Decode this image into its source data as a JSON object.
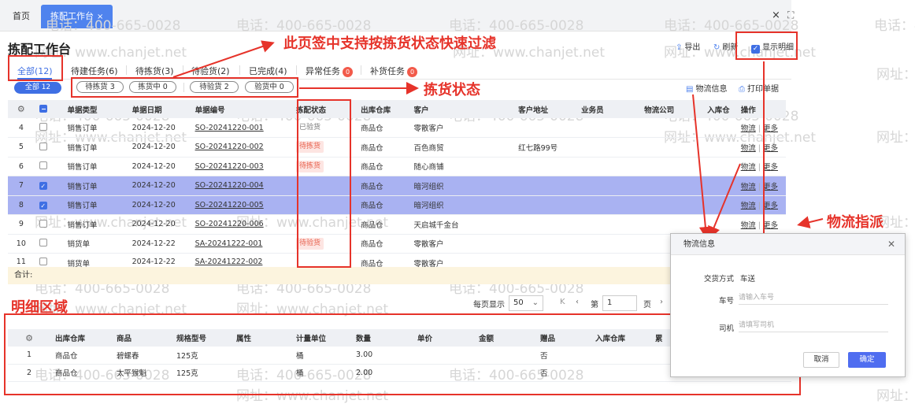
{
  "tabs": {
    "home": "首页",
    "active": "拣配工作台",
    "active_close": "×"
  },
  "window": {
    "close": "×",
    "max": "⛶"
  },
  "watermarks": {
    "phone": "电话：400-665-0028",
    "site": "网址：www.chanjet.net"
  },
  "header": {
    "title": "拣配工作台",
    "export": "导出",
    "refresh": "刷新",
    "show_detail": "显示明细"
  },
  "status_tabs": [
    {
      "label": "全部(12)"
    },
    {
      "label": "待建任务(6)"
    },
    {
      "label": "待拣货(3)"
    },
    {
      "label": "待验货(2)"
    },
    {
      "label": "已完成(4)"
    },
    {
      "label": "异常任务",
      "badge": "0"
    },
    {
      "label": "补货任务",
      "badge": "0"
    }
  ],
  "filters": {
    "all": "全部 12",
    "pills": [
      "待拣货 3",
      "拣货中 0",
      "待验货 2",
      "验货中 0"
    ]
  },
  "actions": {
    "logistics": "物流信息",
    "print": "打印单据"
  },
  "table": {
    "columns": [
      "单据类型",
      "单据日期",
      "单据编号",
      "拣配状态",
      "出库仓库",
      "客户",
      "客户地址",
      "业务员",
      "物流公司",
      "入库仓",
      "操作"
    ],
    "rows": [
      {
        "no": "4",
        "type": "销售订单",
        "date": "2024-12-20",
        "code": "SO-20241220-001",
        "status": "已验货",
        "warehouse": "商品仓",
        "customer": "零散客户",
        "address": "",
        "checked": false
      },
      {
        "no": "5",
        "type": "销售订单",
        "date": "2024-12-20",
        "code": "SO-20241220-002",
        "status": "待拣货",
        "warehouse": "商品仓",
        "customer": "百色商贸",
        "address": "红七路99号",
        "checked": false
      },
      {
        "no": "6",
        "type": "销售订单",
        "date": "2024-12-20",
        "code": "SO-20241220-003",
        "status": "待拣货",
        "warehouse": "商品仓",
        "customer": "随心商铺",
        "address": "",
        "checked": false
      },
      {
        "no": "7",
        "type": "销售订单",
        "date": "2024-12-20",
        "code": "SO-20241220-004",
        "status": "",
        "warehouse": "商品仓",
        "customer": "暗河组织",
        "address": "",
        "checked": true
      },
      {
        "no": "8",
        "type": "销售订单",
        "date": "2024-12-20",
        "code": "SO-20241220-005",
        "status": "",
        "warehouse": "商品仓",
        "customer": "暗河组织",
        "address": "",
        "checked": true
      },
      {
        "no": "9",
        "type": "销售订单",
        "date": "2024-12-20",
        "code": "SO-20241220-006",
        "status": "",
        "warehouse": "商品仓",
        "customer": "天启城千金台",
        "address": "",
        "checked": false
      },
      {
        "no": "10",
        "type": "销货单",
        "date": "2024-12-22",
        "code": "SA-20241222-001",
        "status": "待验货",
        "warehouse": "商品仓",
        "customer": "零散客户",
        "address": "",
        "checked": false
      },
      {
        "no": "11",
        "type": "销货单",
        "date": "2024-12-22",
        "code": "SA-20241222-002",
        "status": "",
        "warehouse": "商品仓",
        "customer": "零散客户",
        "address": "",
        "checked": false
      }
    ],
    "op_logistics": "物流",
    "op_more": "更多",
    "total": "合计:"
  },
  "pager": {
    "per_page": "每页显示",
    "size": "50",
    "page_prefix": "第",
    "page": "1",
    "page_suffix": "页"
  },
  "detail": {
    "columns": [
      "出库仓库",
      "商品",
      "规格型号",
      "属性",
      "计量单位",
      "数量",
      "单价",
      "金额",
      "赠品",
      "入库仓库",
      "累"
    ],
    "rows": [
      {
        "no": "1",
        "warehouse": "商品仓",
        "product": "碧螺春",
        "spec": "125克",
        "attr": "",
        "unit": "桶",
        "qty": "3.00",
        "price": "",
        "amount": "",
        "gift": "否"
      },
      {
        "no": "2",
        "warehouse": "商品仓",
        "product": "太平猴魁",
        "spec": "125克",
        "attr": "",
        "unit": "桶",
        "qty": "2.00",
        "price": "",
        "amount": "",
        "gift": "否"
      }
    ]
  },
  "modal": {
    "title": "物流信息",
    "delivery_label": "交货方式",
    "delivery_value": "车送",
    "plate_label": "车号",
    "plate_placeholder": "请输入车号",
    "driver_label": "司机",
    "driver_placeholder": "请填写司机",
    "cancel": "取消",
    "ok": "确定"
  },
  "annotations": {
    "filter_note": "此页签中支持按拣货状态快速过滤",
    "status_note": "拣货状态",
    "logistics_note": "物流指派",
    "detail_note": "明细区域",
    "color": "#e6332a"
  },
  "colors": {
    "accent": "#3f6fe4",
    "selected_row": "#a9b2f2",
    "badge": "#f25a4a",
    "total_bg": "#fcf4de"
  }
}
